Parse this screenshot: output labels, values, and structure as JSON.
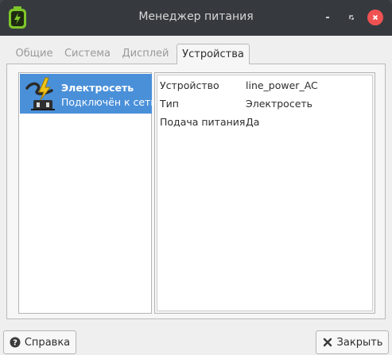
{
  "window": {
    "title": "Менеджер питания"
  },
  "tabs": [
    {
      "label": "Общие",
      "active": false
    },
    {
      "label": "Система",
      "active": false
    },
    {
      "label": "Дисплей",
      "active": false
    },
    {
      "label": "Устройства",
      "active": true
    }
  ],
  "devices": [
    {
      "name": "Электросеть",
      "status": "Подключён к сети",
      "icon": "power-plug-icon",
      "selected": true
    }
  ],
  "details": [
    {
      "key": "Устройство",
      "value": "line_power_AC"
    },
    {
      "key": "Тип",
      "value": "Электросеть"
    },
    {
      "key": "Подача питания",
      "value": "Да"
    }
  ],
  "buttons": {
    "help": "Справка",
    "close": "Закрыть"
  },
  "colors": {
    "selection": "#4a90d9",
    "titlebar": "#363a3f",
    "close_button": "#f05252"
  }
}
